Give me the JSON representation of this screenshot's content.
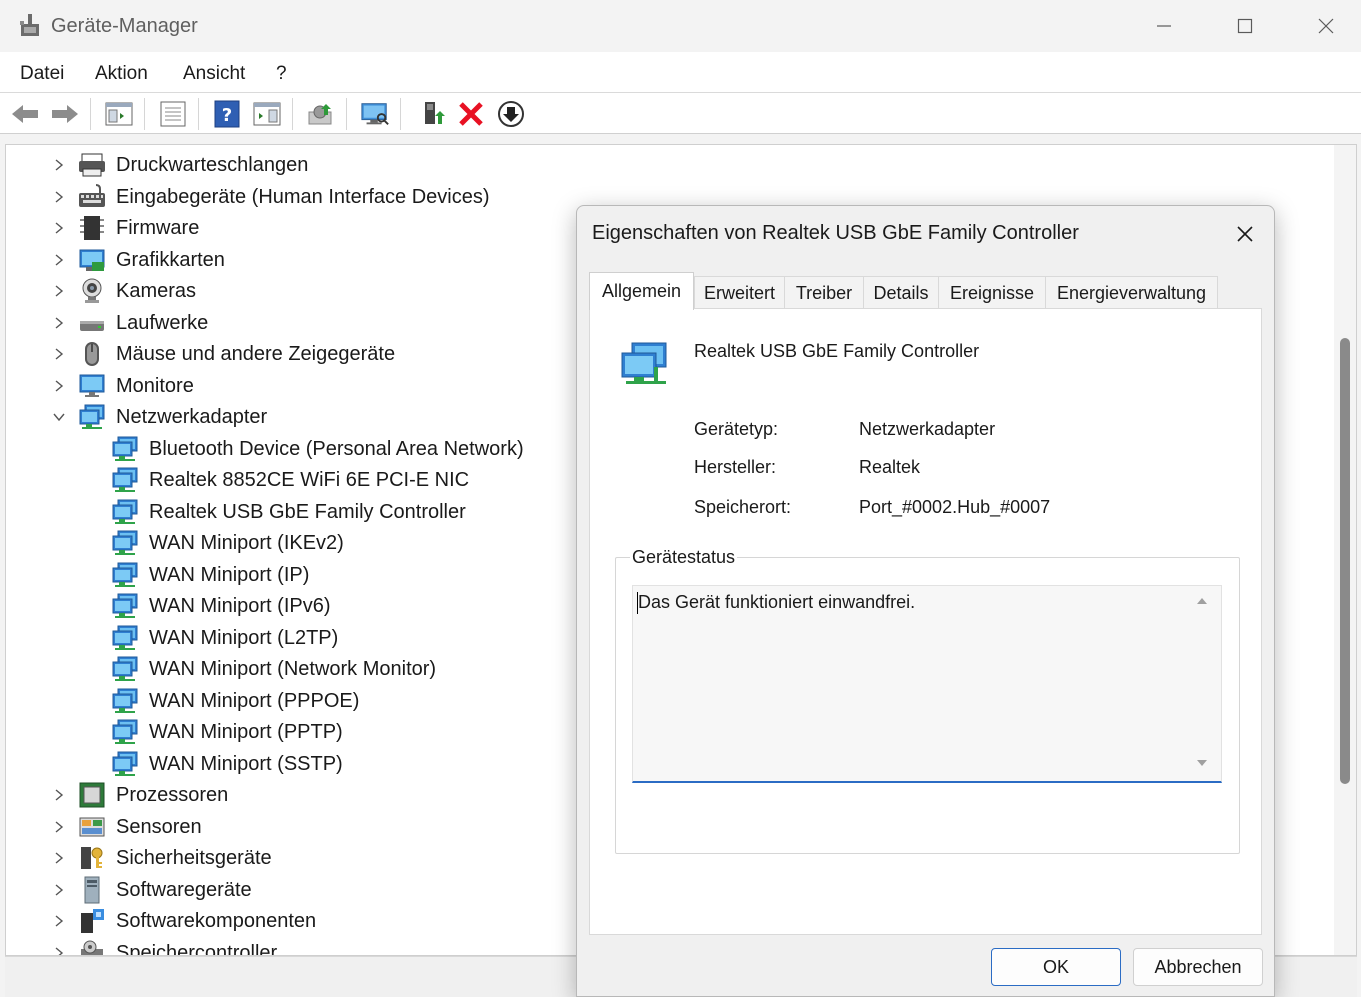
{
  "window": {
    "title": "Geräte-Manager",
    "controls": [
      "minimize-icon",
      "maximize-icon",
      "close-icon"
    ]
  },
  "menu": {
    "items": [
      {
        "label": "Datei"
      },
      {
        "label": "Aktion"
      },
      {
        "label": "Ansicht"
      },
      {
        "label": "?"
      }
    ]
  },
  "toolbar": {
    "buttons": [
      "back-arrow-icon",
      "forward-arrow-icon",
      "show-hide-tree-icon",
      "properties-sheet-icon",
      "help-icon",
      "action-pane-icon",
      "update-driver-icon",
      "scan-hardware-icon",
      "enable-device-icon",
      "uninstall-device-icon",
      "disable-device-icon"
    ]
  },
  "tree": {
    "categories": [
      {
        "label": "Druckwarteschlangen",
        "icon": "printer-icon"
      },
      {
        "label": "Eingabegeräte (Human Interface Devices)",
        "icon": "keyboard-icon"
      },
      {
        "label": "Firmware",
        "icon": "chip-icon"
      },
      {
        "label": "Grafikkarten",
        "icon": "display-adapter-icon"
      },
      {
        "label": "Kameras",
        "icon": "camera-icon"
      },
      {
        "label": "Laufwerke",
        "icon": "drive-icon"
      },
      {
        "label": "Mäuse und andere Zeigegeräte",
        "icon": "mouse-icon"
      },
      {
        "label": "Monitore",
        "icon": "monitor-icon"
      },
      {
        "label": "Netzwerkadapter",
        "icon": "network-icon",
        "expanded": true
      }
    ],
    "network_children": [
      {
        "label": "Bluetooth Device (Personal Area Network)"
      },
      {
        "label": "Realtek 8852CE WiFi 6E PCI-E NIC"
      },
      {
        "label": "Realtek USB GbE Family Controller"
      },
      {
        "label": "WAN Miniport (IKEv2)"
      },
      {
        "label": "WAN Miniport (IP)"
      },
      {
        "label": "WAN Miniport (IPv6)"
      },
      {
        "label": "WAN Miniport (L2TP)"
      },
      {
        "label": "WAN Miniport (Network Monitor)"
      },
      {
        "label": "WAN Miniport (PPPOE)"
      },
      {
        "label": "WAN Miniport (PPTP)"
      },
      {
        "label": "WAN Miniport (SSTP)"
      }
    ],
    "categories_after": [
      {
        "label": "Prozessoren",
        "icon": "processor-icon"
      },
      {
        "label": "Sensoren",
        "icon": "sensor-icon"
      },
      {
        "label": "Sicherheitsgeräte",
        "icon": "security-key-icon"
      },
      {
        "label": "Softwaregeräte",
        "icon": "software-device-icon"
      },
      {
        "label": "Softwarekomponenten",
        "icon": "software-component-icon"
      },
      {
        "label": "Speichercontroller",
        "icon": "storage-controller-icon"
      }
    ]
  },
  "dialog": {
    "title": "Eigenschaften von Realtek USB GbE Family Controller",
    "tabs": [
      {
        "label": "Allgemein",
        "active": true
      },
      {
        "label": "Erweitert"
      },
      {
        "label": "Treiber"
      },
      {
        "label": "Details"
      },
      {
        "label": "Ereignisse"
      },
      {
        "label": "Energieverwaltung"
      }
    ],
    "device_name": "Realtek USB GbE Family Controller",
    "properties": [
      {
        "label": "Gerätetyp:",
        "value": "Netzwerkadapter"
      },
      {
        "label": "Hersteller:",
        "value": "Realtek"
      },
      {
        "label": "Speicherort:",
        "value": "Port_#0002.Hub_#0007"
      }
    ],
    "status_group_title": "Gerätestatus",
    "status_text": "Das Gerät funktioniert einwandfrei.",
    "buttons": {
      "ok": "OK",
      "cancel": "Abbrechen"
    }
  },
  "colors": {
    "accent": "#2b6cc4",
    "uninstall_red": "#e81123"
  }
}
